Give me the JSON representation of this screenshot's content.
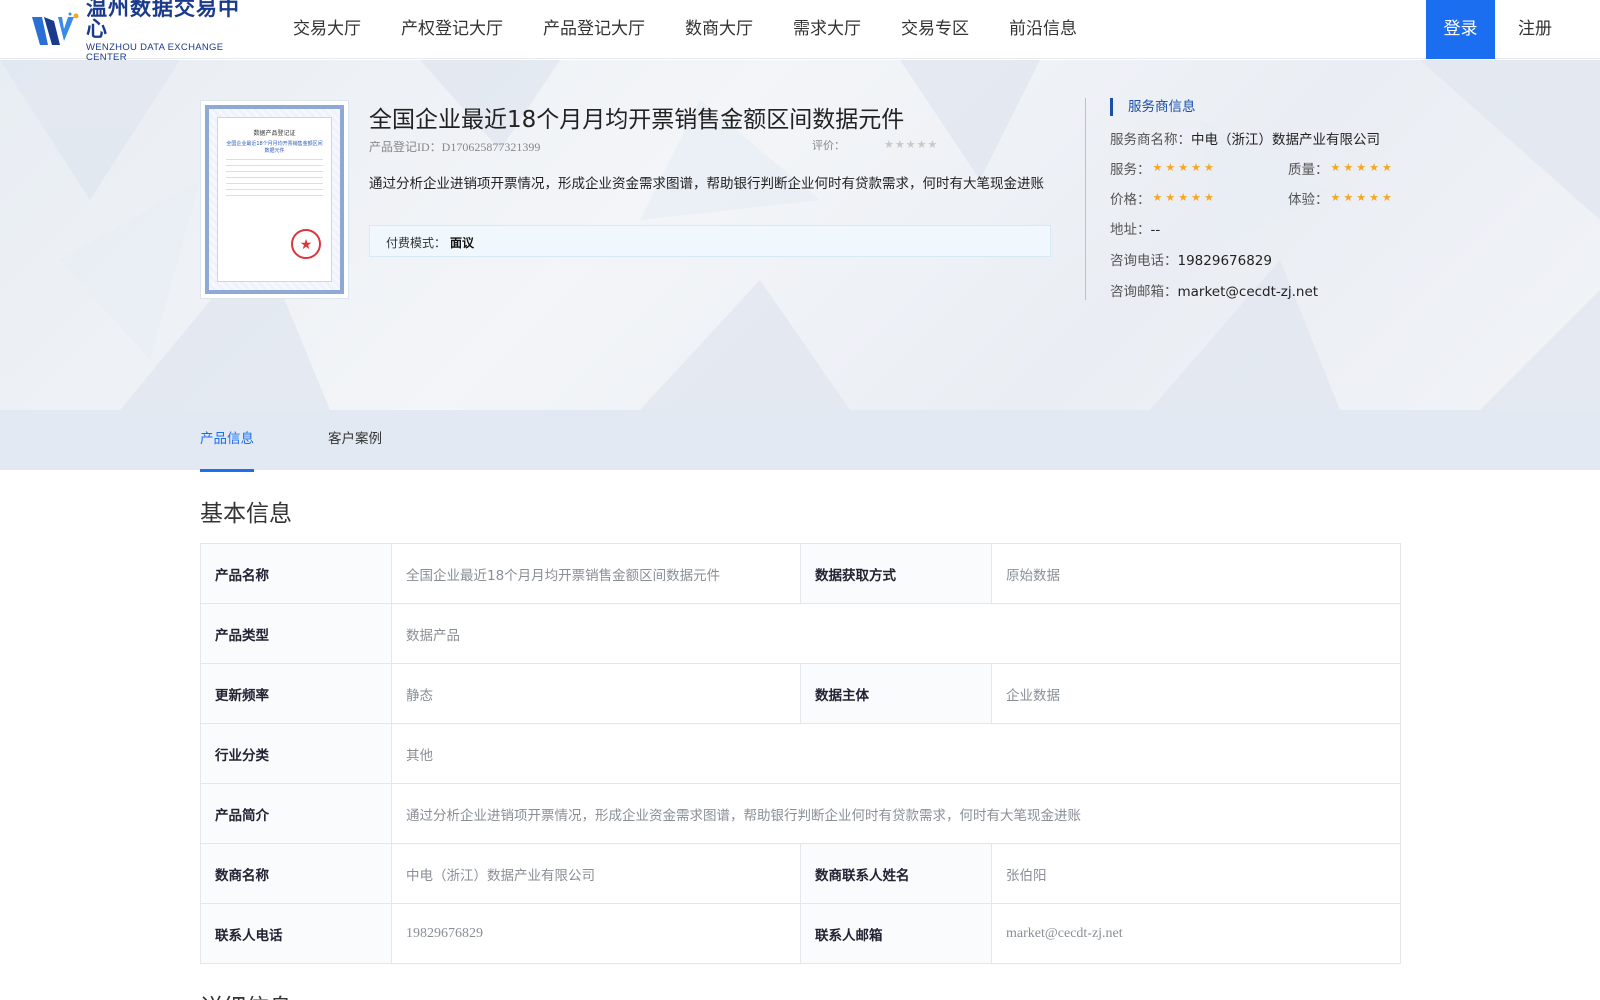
{
  "header": {
    "logo": {
      "cn": "温州数据交易中心",
      "en": "WENZHOU DATA EXCHANGE CENTER"
    },
    "nav": [
      "交易大厅",
      "产权登记大厅",
      "产品登记大厅",
      "数商大厅",
      "需求大厅",
      "交易专区",
      "前沿信息"
    ],
    "login": "登录",
    "register": "注册"
  },
  "product": {
    "title": "全国企业最近18个月月均开票销售金额区间数据元件",
    "reg_id": "产品登记ID：D170625877321399",
    "rating_label": "评价：",
    "rating": 0,
    "description": "通过分析企业进销项开票情况，形成企业资金需求图谱，帮助银行判断企业何时有贷款需求，何时有大笔现金进账",
    "pay_label": "付费模式：",
    "pay_value": "面议"
  },
  "service_provider": {
    "heading": "服务商信息",
    "name_label": "服务商名称：",
    "name": "中电（浙江）数据产业有限公司",
    "service_label": "服务：",
    "service_rating": 5,
    "quality_label": "质量：",
    "quality_rating": 5,
    "price_label": "价格：",
    "price_rating": 5,
    "experience_label": "体验：",
    "experience_rating": 5,
    "address_label": "地址：",
    "address": "--",
    "phone_label": "咨询电话：",
    "phone": "19829676829",
    "email_label": "咨询邮箱：",
    "email": "market@cecdt-zj.net"
  },
  "tabs": [
    "产品信息",
    "客户案例"
  ],
  "basic_info": {
    "title": "基本信息",
    "rows": {
      "product_name": {
        "k": "产品名称",
        "v": "全国企业最近18个月月均开票销售金额区间数据元件"
      },
      "acquire": {
        "k": "数据获取方式",
        "v": "原始数据"
      },
      "product_type": {
        "k": "产品类型",
        "v": "数据产品"
      },
      "frequency": {
        "k": "更新频率",
        "v": "静态"
      },
      "subject": {
        "k": "数据主体",
        "v": "企业数据"
      },
      "industry": {
        "k": "行业分类",
        "v": "其他"
      },
      "intro": {
        "k": "产品简介",
        "v": "通过分析企业进销项开票情况，形成企业资金需求图谱，帮助银行判断企业何时有贷款需求，何时有大笔现金进账"
      },
      "merchant": {
        "k": "数商名称",
        "v": "中电（浙江）数据产业有限公司"
      },
      "contact_name": {
        "k": "数商联系人姓名",
        "v": "张伯阳"
      },
      "contact_phone": {
        "k": "联系人电话",
        "v": "19829676829"
      },
      "contact_email": {
        "k": "联系人邮箱",
        "v": "market@cecdt-zj.net"
      }
    }
  },
  "detail_info": {
    "title": "详细信息"
  },
  "certificate": {
    "title": "数据产品登记证",
    "subtitle": "全国企业最近18个月月均开票销售金额区间数据元件"
  },
  "colors": {
    "accent": "#1b6ef0",
    "brand": "#1a3a8c",
    "star": "#f5a623",
    "star_empty": "#c8c8c8"
  }
}
